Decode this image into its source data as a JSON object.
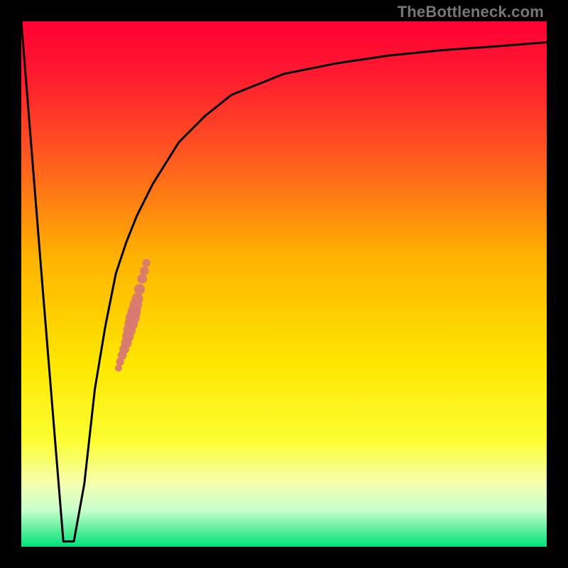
{
  "watermark": "TheBottleneck.com",
  "chart_data": {
    "type": "line",
    "title": "",
    "xlabel": "",
    "ylabel": "",
    "xlim": [
      0,
      100
    ],
    "ylim": [
      0,
      100
    ],
    "grid": false,
    "series": [
      {
        "name": "bottleneck-curve",
        "x": [
          0,
          4,
          8,
          10,
          12,
          14,
          16,
          18,
          20,
          22,
          25,
          30,
          35,
          40,
          50,
          60,
          70,
          80,
          90,
          100
        ],
        "y": [
          100,
          50,
          1,
          1,
          12,
          30,
          42,
          52,
          58,
          63,
          69,
          77,
          82,
          86,
          90,
          92,
          93.5,
          94.5,
          95.2,
          96
        ]
      }
    ],
    "highlight_points": {
      "name": "pink-dots",
      "color": "#d87a70",
      "x": [
        18.5,
        18.8,
        19.2,
        19.6,
        20.0,
        20.3,
        20.6,
        20.9,
        21.2,
        21.5,
        21.8,
        22.1,
        22.5,
        23.0,
        23.4,
        23.8
      ],
      "y": [
        34.0,
        35.2,
        36.4,
        37.6,
        38.8,
        40.0,
        41.2,
        42.4,
        43.6,
        44.8,
        46.0,
        47.2,
        49.0,
        51.0,
        52.5,
        54.0
      ]
    },
    "background_gradient": {
      "type": "vertical",
      "stops": [
        {
          "offset": 0.0,
          "color": "#ff0033"
        },
        {
          "offset": 0.1,
          "color": "#ff1a2f"
        },
        {
          "offset": 0.25,
          "color": "#ff5522"
        },
        {
          "offset": 0.45,
          "color": "#ffb300"
        },
        {
          "offset": 0.65,
          "color": "#ffe600"
        },
        {
          "offset": 0.8,
          "color": "#fcff33"
        },
        {
          "offset": 0.88,
          "color": "#f5ffb0"
        },
        {
          "offset": 0.93,
          "color": "#c8ffcc"
        },
        {
          "offset": 0.97,
          "color": "#55ee99"
        },
        {
          "offset": 1.0,
          "color": "#00e27a"
        }
      ]
    }
  }
}
